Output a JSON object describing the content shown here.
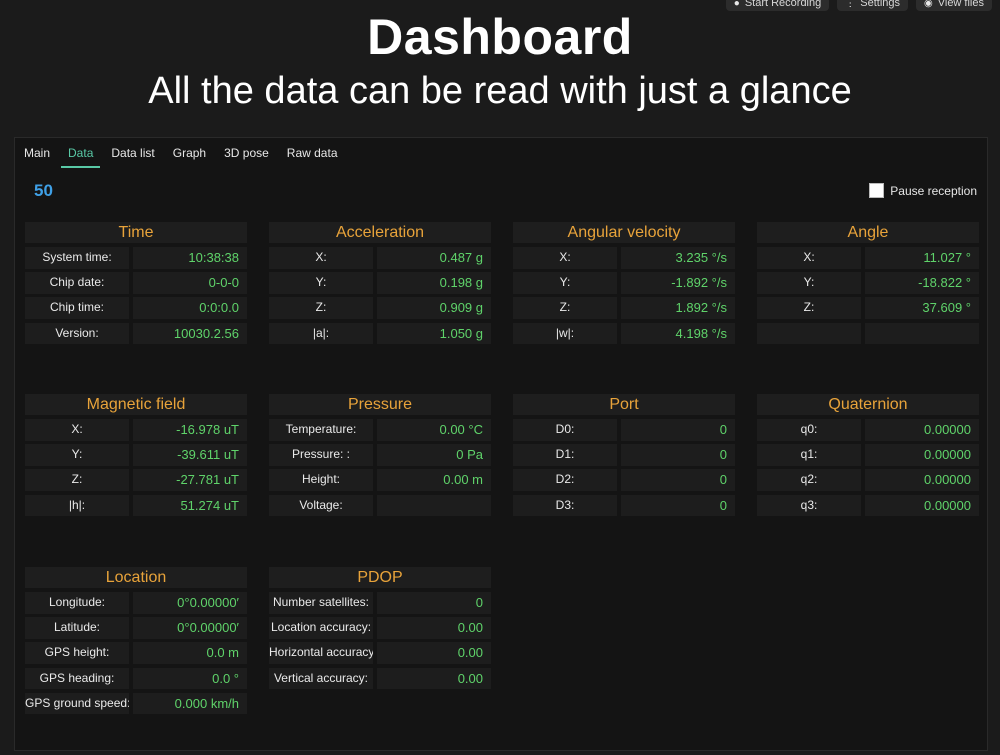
{
  "hero": {
    "title": "Dashboard",
    "subtitle": "All the data can be read with just a glance",
    "actions": [
      {
        "label": "Start Recording",
        "icon": "record-icon"
      },
      {
        "label": "Settings",
        "icon": "settings-icon"
      },
      {
        "label": "View files",
        "icon": "eye-icon"
      }
    ]
  },
  "tabs": [
    "Main",
    "Data",
    "Data list",
    "Graph",
    "3D pose",
    "Raw data"
  ],
  "active_tab": "Data",
  "counter": "50",
  "pause_label": "Pause reception",
  "colors": {
    "accent": "#59c9a6",
    "title": "#e8a33a",
    "value": "#5fd36a",
    "counter": "#3fa0e6"
  },
  "panels": {
    "time": {
      "title": "Time",
      "rows": [
        {
          "label": "System time:",
          "value": "10:38:38"
        },
        {
          "label": "Chip date:",
          "value": "0-0-0"
        },
        {
          "label": "Chip time:",
          "value": "0:0:0.0"
        },
        {
          "label": "Version:",
          "value": "10030.2.56"
        }
      ]
    },
    "acceleration": {
      "title": "Acceleration",
      "rows": [
        {
          "label": "X:",
          "value": "0.487 g"
        },
        {
          "label": "Y:",
          "value": "0.198 g"
        },
        {
          "label": "Z:",
          "value": "0.909 g"
        },
        {
          "label": "|a|:",
          "value": "1.050 g"
        }
      ]
    },
    "angular_velocity": {
      "title": "Angular velocity",
      "rows": [
        {
          "label": "X:",
          "value": "3.235 °/s"
        },
        {
          "label": "Y:",
          "value": "-1.892 °/s"
        },
        {
          "label": "Z:",
          "value": "1.892 °/s"
        },
        {
          "label": "|w|:",
          "value": "4.198 °/s"
        }
      ]
    },
    "angle": {
      "title": "Angle",
      "rows": [
        {
          "label": "X:",
          "value": "11.027 °"
        },
        {
          "label": "Y:",
          "value": "-18.822 °"
        },
        {
          "label": "Z:",
          "value": "37.609 °"
        },
        {
          "label": "",
          "value": ""
        }
      ]
    },
    "magnetic_field": {
      "title": "Magnetic field",
      "rows": [
        {
          "label": "X:",
          "value": "-16.978 uT"
        },
        {
          "label": "Y:",
          "value": "-39.611 uT"
        },
        {
          "label": "Z:",
          "value": "-27.781 uT"
        },
        {
          "label": "|h|:",
          "value": "51.274 uT"
        }
      ]
    },
    "pressure": {
      "title": "Pressure",
      "rows": [
        {
          "label": "Temperature:",
          "value": "0.00 °C"
        },
        {
          "label": "Pressure: :",
          "value": "0 Pa"
        },
        {
          "label": "Height:",
          "value": "0.00 m"
        },
        {
          "label": "Voltage:",
          "value": ""
        }
      ]
    },
    "port": {
      "title": "Port",
      "rows": [
        {
          "label": "D0:",
          "value": "0"
        },
        {
          "label": "D1:",
          "value": "0"
        },
        {
          "label": "D2:",
          "value": "0"
        },
        {
          "label": "D3:",
          "value": "0"
        }
      ]
    },
    "quaternion": {
      "title": "Quaternion",
      "rows": [
        {
          "label": "q0:",
          "value": "0.00000"
        },
        {
          "label": "q1:",
          "value": "0.00000"
        },
        {
          "label": "q2:",
          "value": "0.00000"
        },
        {
          "label": "q3:",
          "value": "0.00000"
        }
      ]
    },
    "location": {
      "title": "Location",
      "rows": [
        {
          "label": "Longitude:",
          "value": "0°0.00000′"
        },
        {
          "label": "Latitude:",
          "value": "0°0.00000′"
        },
        {
          "label": "GPS height:",
          "value": "0.0 m"
        },
        {
          "label": "GPS heading:",
          "value": "0.0 °"
        },
        {
          "label": "GPS ground speed:",
          "value": "0.000 km/h"
        }
      ]
    },
    "pdop": {
      "title": "PDOP",
      "rows": [
        {
          "label": "Number satellites:",
          "value": "0"
        },
        {
          "label": "Location accuracy:",
          "value": "0.00"
        },
        {
          "label": "Horizontal accuracy",
          "value": "0.00"
        },
        {
          "label": "Vertical accuracy:",
          "value": "0.00"
        }
      ]
    }
  }
}
